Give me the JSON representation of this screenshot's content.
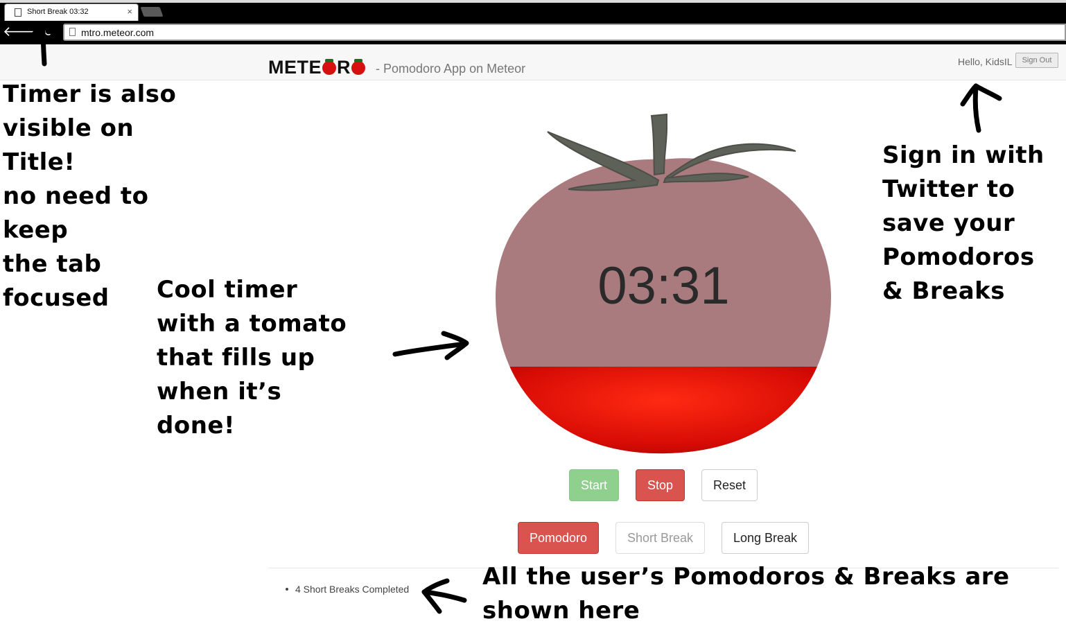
{
  "browser": {
    "tab_title": "Short Break 03:32",
    "tab_close": "×",
    "url": "mtro.meteor.com",
    "back_glyph": "🡐",
    "reload_glyph": "↻"
  },
  "header": {
    "brand_prefix": "METE",
    "brand_mid": "R",
    "tagline": "- Pomodoro App on Meteor",
    "greeting": "Hello, KidsIL",
    "sign_out_label": "Sign Out"
  },
  "timer": {
    "display": "03:31",
    "fill_fraction": 0.3
  },
  "controls": {
    "start_label": "Start",
    "stop_label": "Stop",
    "reset_label": "Reset"
  },
  "modes": {
    "pomodoro_label": "Pomodoro",
    "short_break_label": "Short Break",
    "long_break_label": "Long Break"
  },
  "history": {
    "items": [
      "4 Short Breaks Completed"
    ]
  },
  "annotations": {
    "title_note": [
      "Timer is also",
      "visible on Title!",
      "no need to keep",
      "the tab focused"
    ],
    "timer_note": [
      "Cool timer",
      "with a tomato",
      "that fills up",
      "when it’s done!"
    ],
    "signin_note": [
      "Sign in with",
      "Twitter to",
      "save your",
      "Pomodoros",
      "& Breaks"
    ],
    "history_note": [
      "All the user’s Pomodoros & Breaks are",
      "shown here"
    ]
  },
  "colors": {
    "danger": "#d9534f",
    "success_muted": "#8fd08f",
    "tomato_red": "#d60f0f"
  }
}
